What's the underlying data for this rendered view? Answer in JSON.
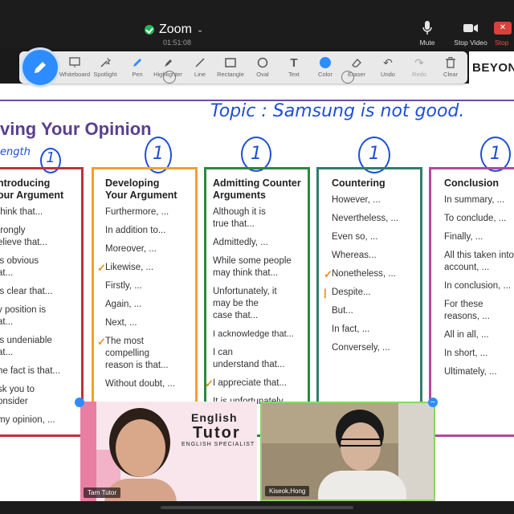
{
  "app": {
    "title": "Zoom",
    "timer": "01:51:08",
    "controls": [
      {
        "label": "Mute",
        "icon": "microphone-icon"
      },
      {
        "label": "Stop Video",
        "icon": "video-camera-icon"
      },
      {
        "label": "Stop",
        "icon": "stop-share-icon"
      }
    ]
  },
  "toolbar": {
    "tools": [
      {
        "label": "Whiteboard",
        "icon": "whiteboard-icon"
      },
      {
        "label": "Spotlight",
        "icon": "spotlight-icon"
      },
      {
        "label": "Pen",
        "icon": "pen-icon"
      },
      {
        "label": "Highlighter",
        "icon": "highlighter-icon"
      },
      {
        "label": "Line",
        "icon": "line-icon"
      },
      {
        "label": "Rectangle",
        "icon": "rectangle-icon"
      },
      {
        "label": "Oval",
        "icon": "oval-icon"
      },
      {
        "label": "Text",
        "icon": "text-icon"
      },
      {
        "label": "Color",
        "icon": "color-icon"
      },
      {
        "label": "Eraser",
        "icon": "eraser-icon"
      },
      {
        "label": "Undo",
        "icon": "undo-icon"
      },
      {
        "label": "Redo",
        "icon": "redo-icon"
      },
      {
        "label": "Clear",
        "icon": "trash-icon"
      }
    ],
    "brand": "BEYON",
    "color": "#2d8cff"
  },
  "slide": {
    "title": "ving Your Opinion",
    "handwriting": {
      "topic": "Topic :  Samsung is not good.",
      "left_note": "ength"
    },
    "cards": [
      {
        "title": "ntroducing\nour Argument",
        "color": "#c0313b",
        "phrases": [
          "think that...",
          "trongly\nelieve that...",
          "is obvious\nat...",
          "is clear that...",
          "y position is\nat...",
          "is undeniable\nat...",
          "he fact is that...",
          "sk you to\nonsider",
          "my opinion, ..."
        ]
      },
      {
        "title": "Developing\nYour Argument",
        "color": "#f0a12c",
        "phrases": [
          "Furthermore, ...",
          "In addition to...",
          "Moreover, ...",
          "Likewise, ...",
          "Firstly, ...",
          "Again, ...",
          "Next, ...",
          "The most\ncompelling\nreason is that...",
          "Without doubt, ..."
        ]
      },
      {
        "title": "Admitting Counter\nArguments",
        "color": "#2a8a3e",
        "phrases": [
          "Although it is\ntrue that...",
          "Admittedly, ...",
          "While some people\nmay think that...",
          "Unfortunately, it\nmay be the\ncase that...",
          "I acknowledge that...",
          "I can\nunderstand that...",
          "I appreciate that...",
          "It is unfortunately"
        ]
      },
      {
        "title": "Countering",
        "color": "#2e7f6a",
        "phrases": [
          "However, ...",
          "Nevertheless, ...",
          "Even so, ...",
          "Whereas...",
          "Nonetheless, ...",
          "Despite...",
          "But...",
          "In fact, ...",
          "Conversely, ..."
        ]
      },
      {
        "title": "Conclusion",
        "color": "#b04a9c",
        "phrases": [
          "In summary, ...",
          "To conclude, ...",
          "Finally, ...",
          "All this taken into\naccount, ...",
          "In conclusion, ...",
          "For these\nreasons, ...",
          "All in all, ...",
          "In short, ...",
          "Ultimately, ..."
        ]
      }
    ],
    "handwritten_marks": [
      "1",
      "1",
      "1",
      "1",
      "1"
    ]
  },
  "videos": [
    {
      "name": "Tarn Tutor",
      "banner": [
        "English",
        "Tutor",
        "ENGLISH SPECIALIST"
      ]
    },
    {
      "name": "Kiseok,Hong"
    }
  ]
}
